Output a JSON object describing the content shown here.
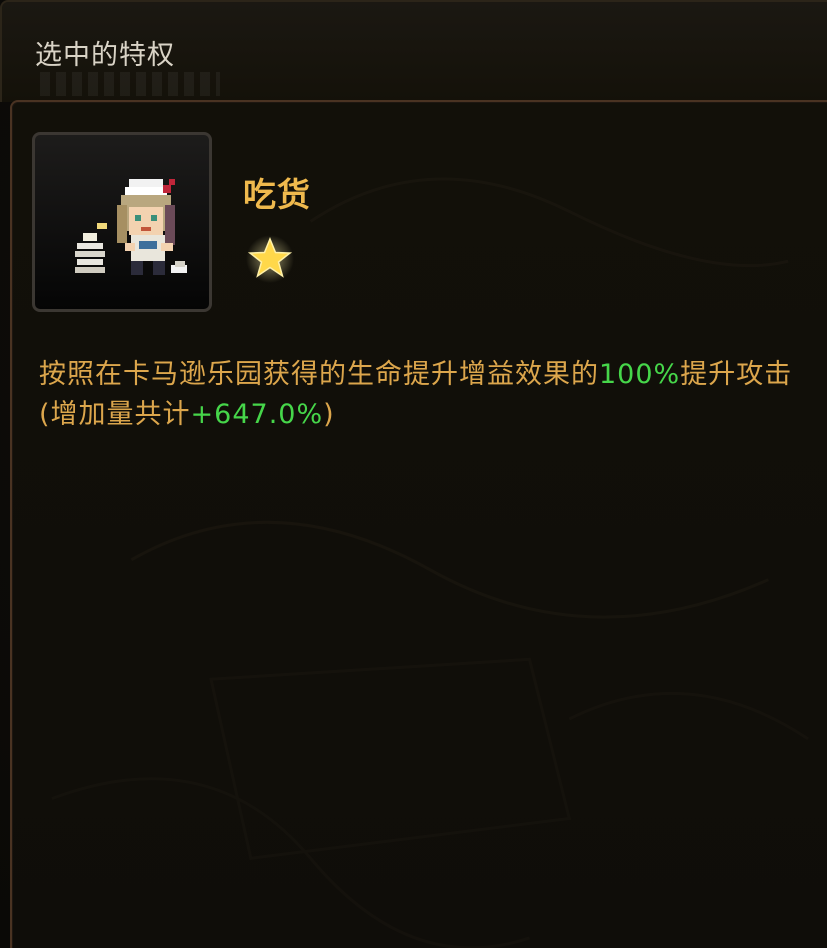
{
  "window": {
    "title": "选中的特权"
  },
  "perk": {
    "name": "吃货",
    "stars": 1,
    "icon": "chef-girl-eating-icon",
    "description": {
      "part1": "按照在卡马逊乐园获得的生命提升增益效果的",
      "value1": "100%",
      "part2": "提升攻击(增加量共计",
      "value2": "+647.0%",
      "part3": ")"
    }
  },
  "colors": {
    "accent_gold": "#efb94d",
    "text_gold": "#dca64c",
    "highlight_green": "#46d64a",
    "title_text": "#d9d3c6",
    "panel_border": "#4a3322"
  }
}
